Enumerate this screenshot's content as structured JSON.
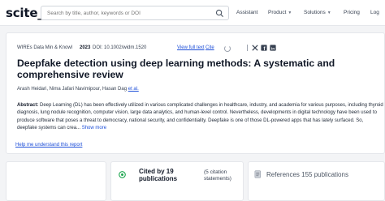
{
  "header": {
    "logo": "scite_",
    "search_placeholder": "Search by title, author, keywords or DOI",
    "nav": [
      {
        "label": "Assistant",
        "has_dropdown": false
      },
      {
        "label": "Product",
        "has_dropdown": true
      },
      {
        "label": "Solutions",
        "has_dropdown": true
      },
      {
        "label": "Pricing",
        "has_dropdown": false
      },
      {
        "label": "Log",
        "has_dropdown": false
      }
    ]
  },
  "paper": {
    "journal": "WIREs Data Min & Knowl",
    "year": "2023",
    "doi": "DOI: 10.1002/widm.1520",
    "view_full_text": "View full text",
    "cite": "Cite",
    "title": "Deepfake detection using deep learning methods: A systematic and comprehensive review",
    "authors": "Arash Heidari, Nima Jafari Navimipour, Hasan Dag",
    "et_al": "et al.",
    "abstract_label": "Abstract:",
    "abstract": "Deep Learning (DL) has been effectively utilized in various complicated challenges in healthcare, industry, and academia for various purposes, including thyroid diagnosis, lung nodule recognition, computer vision, large data analytics, and human-level control. Nevertheless, developments in digital technology have been used to produce software that poses a threat to democracy, national security, and confidentiality. Deepfake is one of those DL-powered apps that has lately surfaced. So, deepfake systems can crea...",
    "show_more": "Show more",
    "help_link": "Help me understand this report",
    "share_icons": [
      "twitter-icon",
      "facebook-icon",
      "linkedin-icon"
    ]
  },
  "citations": {
    "cited_by": "Cited by 19 publications",
    "citation_statements": "(5 citation statements)",
    "references": "References 155 publications"
  },
  "colors": {
    "link": "#1d4ed8",
    "accent_green": "#16a34a"
  }
}
